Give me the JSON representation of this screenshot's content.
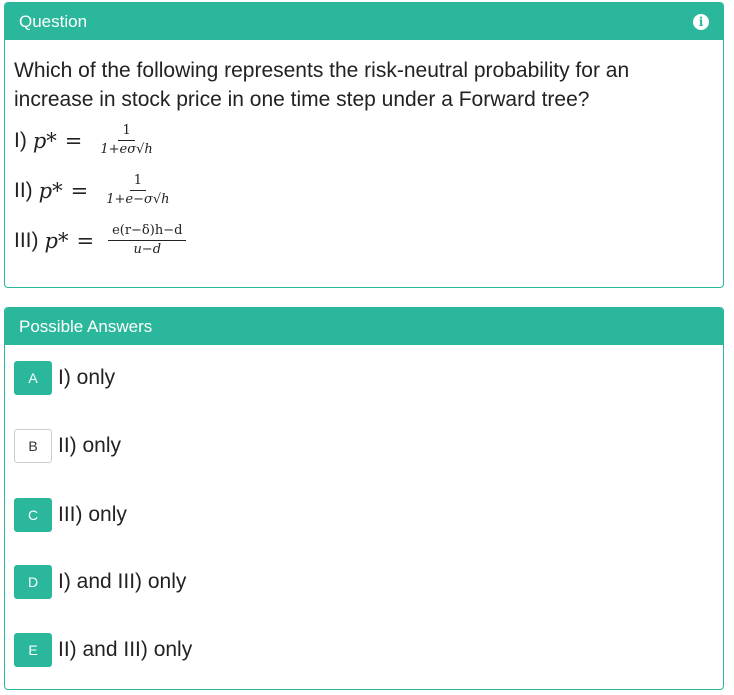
{
  "question_panel": {
    "title": "Question",
    "icon": "info-icon",
    "text": "Which of the following represents the risk-neutral probability for an increase in stock price in one time step under a Forward tree?",
    "options": [
      {
        "label": "I)",
        "lhs": "p*",
        "eq": "=",
        "num": "1",
        "den": "1+eσ√h"
      },
      {
        "label": "II)",
        "lhs": "p*",
        "eq": "=",
        "num": "1",
        "den": "1+e−σ√h"
      },
      {
        "label": "III)",
        "lhs": "p*",
        "eq": "=",
        "num": "e(r−δ)h−d",
        "den": "u−d"
      }
    ]
  },
  "answers_panel": {
    "title": "Possible Answers",
    "answers": [
      {
        "letter": "A",
        "text": "I) only",
        "style": "filled"
      },
      {
        "letter": "B",
        "text": "II) only",
        "style": "empty"
      },
      {
        "letter": "C",
        "text": "III) only",
        "style": "filled"
      },
      {
        "letter": "D",
        "text": "I) and III) only",
        "style": "filled"
      },
      {
        "letter": "E",
        "text": "II) and III) only",
        "style": "filled"
      }
    ]
  },
  "colors": {
    "accent": "#2bb79b"
  }
}
